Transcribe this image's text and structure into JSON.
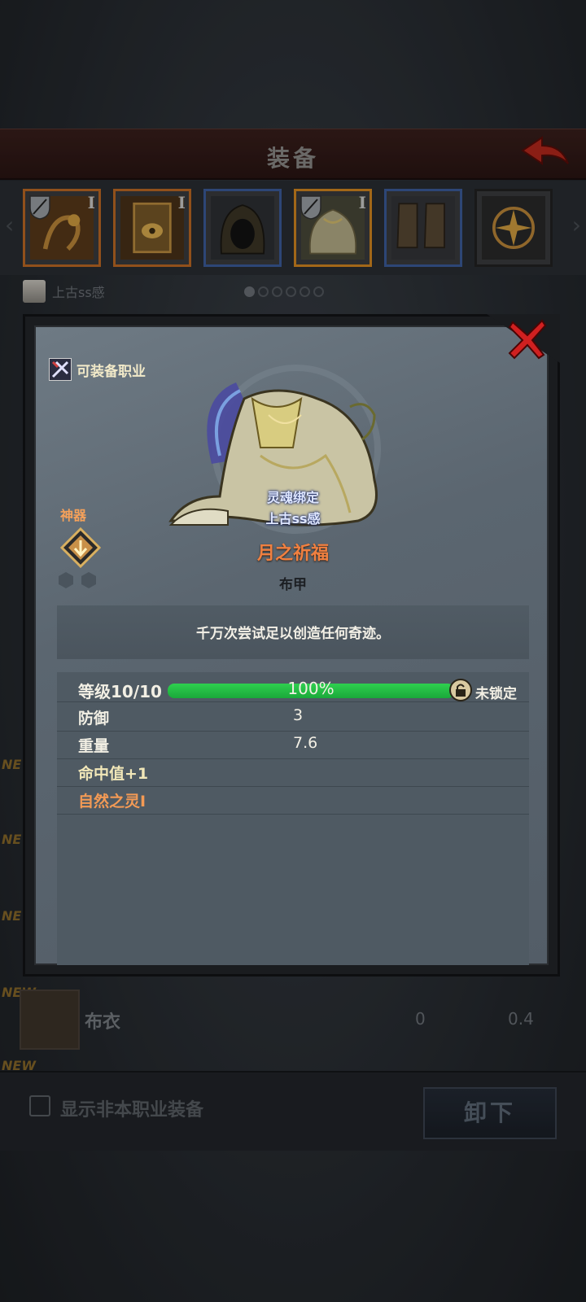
{
  "header": {
    "title": "装备"
  },
  "slots": [
    {
      "name": "necklace",
      "tier": "I",
      "border": "#c26b24"
    },
    {
      "name": "ring",
      "tier": "I",
      "border": "#c26b24"
    },
    {
      "name": "helmet",
      "tier": "",
      "border": "#3c5e9e"
    },
    {
      "name": "armor",
      "tier": "I",
      "border": "#d88a20"
    },
    {
      "name": "boots",
      "tier": "",
      "border": "#3c5e9e"
    },
    {
      "name": "amulet",
      "tier": "",
      "border": "#222222"
    }
  ],
  "character": {
    "name": "上古ss感",
    "page_index": 0,
    "page_count": 6
  },
  "background_list": {
    "new_tag": "NEW",
    "row": {
      "name": "布衣",
      "value1": "0",
      "value2": "0.4"
    }
  },
  "bottom": {
    "checkbox_label": "显示非本职业装备",
    "unequip_label": "卸下"
  },
  "modal": {
    "can_equip_label": "可装备职业",
    "artifact_label": "神器",
    "soul_bound": "灵魂绑定",
    "soul_owner": "上古ss感",
    "item_name": "月之祈福",
    "item_type": "布甲",
    "description": "千万次尝试足以创造任何奇迹。",
    "level": {
      "label": "等级10/10",
      "percent_text": "100%",
      "fraction": 1.0,
      "lock_label": "未锁定"
    },
    "stats": [
      {
        "label": "防御",
        "value": "3"
      },
      {
        "label": "重量",
        "value": "7.6"
      }
    ],
    "bonuses": [
      "命中值+1",
      "自然之灵I"
    ]
  },
  "colors": {
    "item_name": "#f08040",
    "progress": "#2fd04f",
    "header_bg": "#3a1f1c"
  }
}
